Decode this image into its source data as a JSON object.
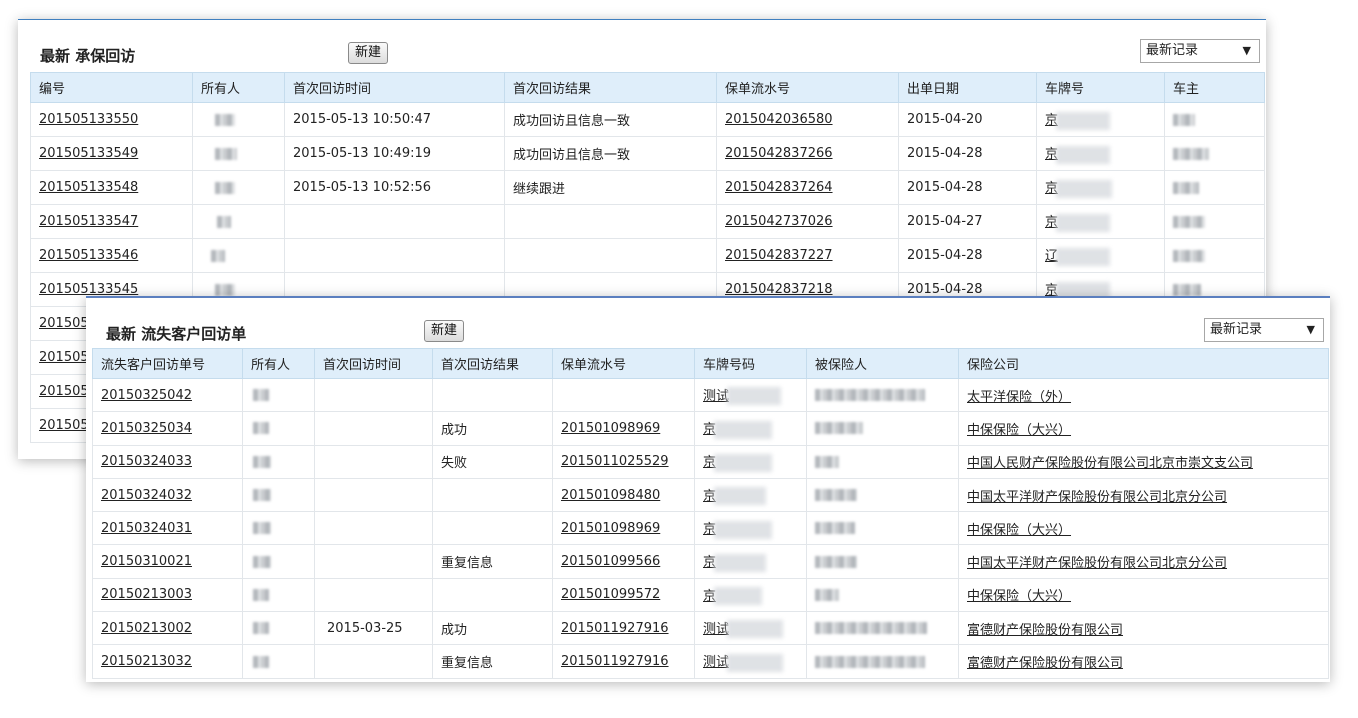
{
  "panel_a": {
    "title": "最新 承保回访",
    "new_button": "新建",
    "filter": "最新记录",
    "columns": [
      "编号",
      "所有人",
      "首次回访时间",
      "首次回访结果",
      "保单流水号",
      "出单日期",
      "车牌号",
      "车主"
    ],
    "rows": [
      {
        "id": "201505133550",
        "visit_time": "2015-05-13 10:50:47",
        "result": "成功回访且信息一致",
        "policy": "2015042036580",
        "date": "2015-04-20",
        "plate_prefix": "京"
      },
      {
        "id": "201505133549",
        "visit_time": "2015-05-13 10:49:19",
        "result": "成功回访且信息一致",
        "policy": "2015042837266",
        "date": "2015-04-28",
        "plate_prefix": "京"
      },
      {
        "id": "201505133548",
        "visit_time": "2015-05-13 10:52:56",
        "result": "继续跟进",
        "policy": "2015042837264",
        "date": "2015-04-28",
        "plate_prefix": "京"
      },
      {
        "id": "201505133547",
        "visit_time": "",
        "result": "",
        "policy": "2015042737026",
        "date": "2015-04-27",
        "plate_prefix": "京"
      },
      {
        "id": "201505133546",
        "visit_time": "",
        "result": "",
        "policy": "2015042837227",
        "date": "2015-04-28",
        "plate_prefix": "辽"
      },
      {
        "id": "201505133545",
        "visit_time": "",
        "result": "",
        "policy": "2015042837218",
        "date": "2015-04-28",
        "plate_prefix": "京"
      },
      {
        "id": "201505",
        "visit_time": "",
        "result": "",
        "policy": "",
        "date": "",
        "plate_prefix": ""
      },
      {
        "id": "201505",
        "visit_time": "",
        "result": "",
        "policy": "",
        "date": "",
        "plate_prefix": ""
      },
      {
        "id": "201505",
        "visit_time": "",
        "result": "",
        "policy": "",
        "date": "",
        "plate_prefix": ""
      },
      {
        "id": "201505",
        "visit_time": "",
        "result": "",
        "policy": "",
        "date": "",
        "plate_prefix": ""
      }
    ]
  },
  "panel_b": {
    "title": "最新 流失客户回访单",
    "new_button": "新建",
    "filter": "最新记录",
    "columns": [
      "流失客户回访单号",
      "所有人",
      "首次回访时间",
      "首次回访结果",
      "保单流水号",
      "车牌号码",
      "被保险人",
      "保险公司"
    ],
    "rows": [
      {
        "id": "20150325042",
        "visit_time": "",
        "result": "",
        "policy": "",
        "plate_prefix": "测试",
        "company": "太平洋保险（外）"
      },
      {
        "id": "20150325034",
        "visit_time": "",
        "result": "成功",
        "policy": "201501098969",
        "plate_prefix": "京",
        "company": "中保保险（大兴）"
      },
      {
        "id": "20150324033",
        "visit_time": "",
        "result": "失败",
        "policy": "2015011025529",
        "plate_prefix": "京",
        "company": "中国人民财产保险股份有限公司北京市崇文支公司"
      },
      {
        "id": "20150324032",
        "visit_time": "",
        "result": "",
        "policy": "201501098480",
        "plate_prefix": "京",
        "company": "中国太平洋财产保险股份有限公司北京分公司"
      },
      {
        "id": "20150324031",
        "visit_time": "",
        "result": "",
        "policy": "201501098969",
        "plate_prefix": "京",
        "company": "中保保险（大兴）"
      },
      {
        "id": "20150310021",
        "visit_time": "",
        "result": "重复信息",
        "policy": "201501099566",
        "plate_prefix": "京",
        "company": "中国太平洋财产保险股份有限公司北京分公司"
      },
      {
        "id": "20150213003",
        "visit_time": "",
        "result": "",
        "policy": "201501099572",
        "plate_prefix": "京",
        "company": "中保保险（大兴）"
      },
      {
        "id": "20150213002",
        "visit_time": "2015-03-25",
        "result": "成功",
        "policy": "2015011927916",
        "plate_prefix": "测试",
        "company": "富德财产保险股份有限公司"
      },
      {
        "id": "20150213032",
        "visit_time": "",
        "result": "重复信息",
        "policy": "2015011927916",
        "plate_prefix": "测试",
        "company": "富德财产保险股份有限公司"
      }
    ]
  }
}
